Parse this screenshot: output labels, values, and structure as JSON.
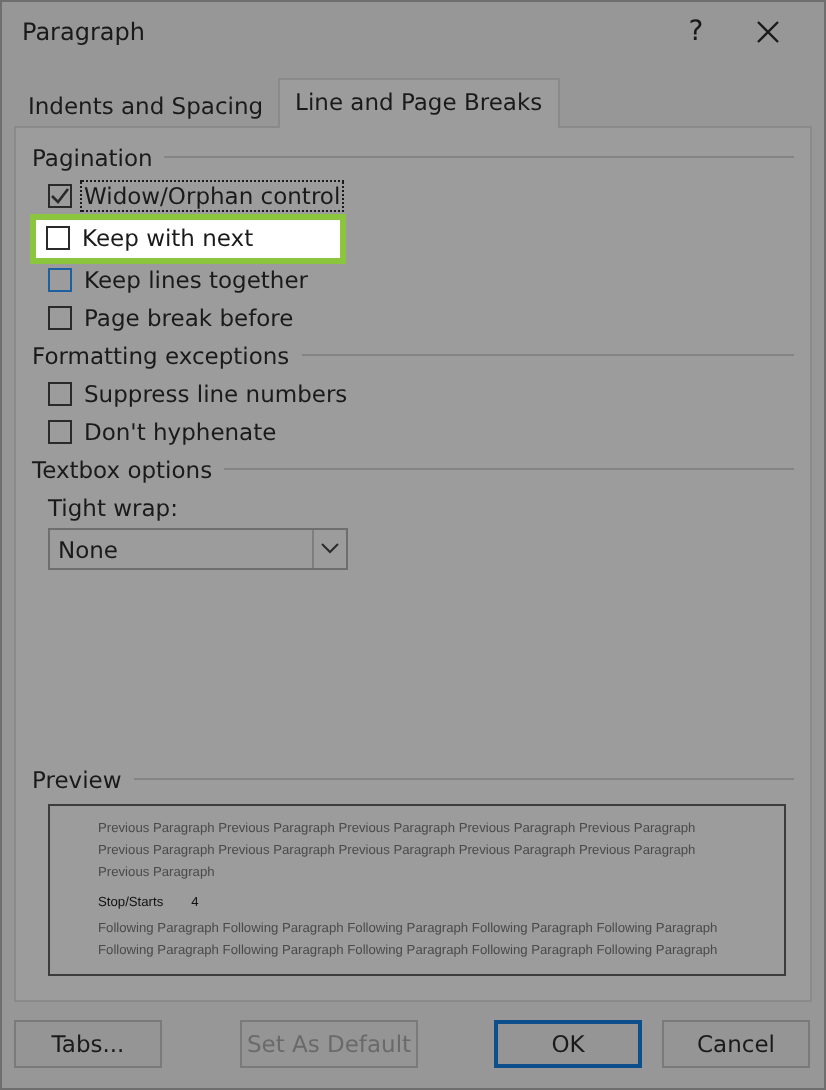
{
  "window": {
    "title": "Paragraph",
    "help": "?"
  },
  "tabs": [
    {
      "label": "Indents and Spacing",
      "selected": false
    },
    {
      "label": "Line and Page Breaks",
      "selected": true
    }
  ],
  "sections": [
    {
      "title": "Pagination",
      "items": [
        {
          "label": "Widow/Orphan control",
          "checked": true,
          "focused": true,
          "highlighted": false,
          "hovered": false
        },
        {
          "label": "Keep with next",
          "checked": false,
          "focused": false,
          "highlighted": true,
          "hovered": false
        },
        {
          "label": "Keep lines together",
          "checked": false,
          "focused": false,
          "highlighted": false,
          "hovered": true
        },
        {
          "label": "Page break before",
          "checked": false,
          "focused": false,
          "highlighted": false,
          "hovered": false
        }
      ]
    },
    {
      "title": "Formatting exceptions",
      "items": [
        {
          "label": "Suppress line numbers",
          "checked": false,
          "focused": false,
          "highlighted": false,
          "hovered": false
        },
        {
          "label": "Don't hyphenate",
          "checked": false,
          "focused": false,
          "highlighted": false,
          "hovered": false
        }
      ]
    }
  ],
  "textbox_options": {
    "title": "Textbox options",
    "tight_wrap": {
      "label": "Tight wrap:",
      "value": "None"
    }
  },
  "preview": {
    "title": "Preview",
    "previous": "Previous Paragraph Previous Paragraph Previous Paragraph Previous Paragraph Previous Paragraph Previous Paragraph Previous Paragraph Previous Paragraph Previous Paragraph Previous Paragraph Previous Paragraph",
    "sample_label": "Stop/Starts",
    "sample_value": "4",
    "following": "Following Paragraph Following Paragraph Following Paragraph Following Paragraph Following Paragraph Following Paragraph Following Paragraph Following Paragraph Following Paragraph Following Paragraph"
  },
  "buttons": [
    {
      "label": "Tabs...",
      "disabled": false,
      "default": false
    },
    {
      "label": "Set As Default",
      "disabled": true,
      "default": false
    },
    {
      "label": "OK",
      "disabled": false,
      "default": true
    },
    {
      "label": "Cancel",
      "disabled": false,
      "default": false
    }
  ]
}
